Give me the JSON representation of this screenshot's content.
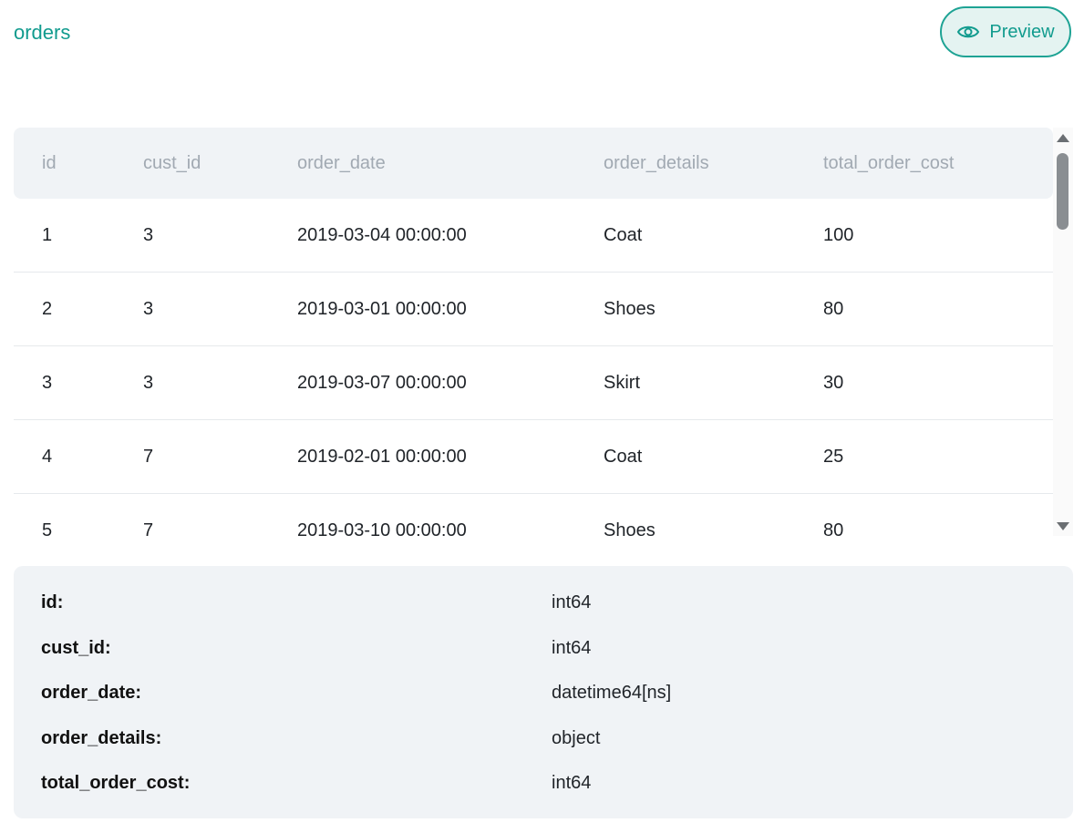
{
  "title": "orders",
  "preview_button": {
    "label": "Preview",
    "icon": "eye-icon"
  },
  "accent_color": "#119b8e",
  "table": {
    "columns": [
      "id",
      "cust_id",
      "order_date",
      "order_details",
      "total_order_cost"
    ],
    "rows": [
      [
        "1",
        "3",
        "2019-03-04 00:00:00",
        "Coat",
        "100"
      ],
      [
        "2",
        "3",
        "2019-03-01 00:00:00",
        "Shoes",
        "80"
      ],
      [
        "3",
        "3",
        "2019-03-07 00:00:00",
        "Skirt",
        "30"
      ],
      [
        "4",
        "7",
        "2019-02-01 00:00:00",
        "Coat",
        "25"
      ],
      [
        "5",
        "7",
        "2019-03-10 00:00:00",
        "Shoes",
        "80"
      ]
    ]
  },
  "schema": [
    {
      "name": "id:",
      "dtype": "int64"
    },
    {
      "name": "cust_id:",
      "dtype": "int64"
    },
    {
      "name": "order_date:",
      "dtype": "datetime64[ns]"
    },
    {
      "name": "order_details:",
      "dtype": "object"
    },
    {
      "name": "total_order_cost:",
      "dtype": "int64"
    }
  ]
}
